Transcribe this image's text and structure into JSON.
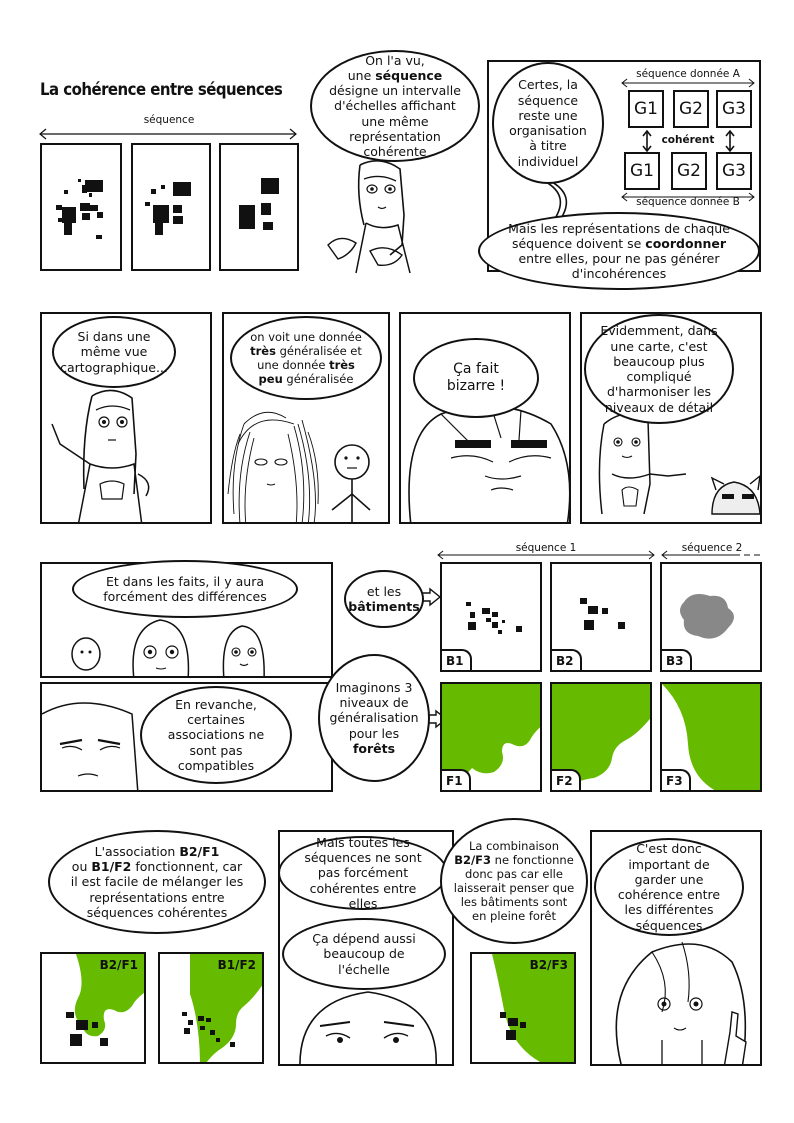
{
  "title": "La cohérence entre séquences",
  "row1": {
    "sequence_label": "séquence",
    "bubble_intro": [
      "On l'a vu,",
      "une ",
      "séquence",
      " désigne un intervalle d'échelles affichant une même représentation cohérente"
    ],
    "bubble_certes": "Certes, la séquence reste une organisation à titre individuel",
    "seq_a_label": "séquence donnée A",
    "seq_b_label": "séquence donnée B",
    "coherent_label": "cohérent",
    "groups_a": [
      "G1",
      "G2",
      "G3"
    ],
    "groups_b": [
      "G1",
      "G2",
      "G3"
    ],
    "bubble_mais": [
      "Mais les représentations de chaque séquence doivent se ",
      "coordonner",
      " entre elles, pour ne pas générer d'incohérences"
    ]
  },
  "row2": {
    "b1": "Si dans une même vue cartographique...",
    "b2": [
      "on voit une donnée ",
      "très",
      " généralisée et une donnée ",
      "très peu",
      " généralisée"
    ],
    "b3": "Ça fait bizarre !",
    "b4": "Evidemment, dans une carte, c'est beaucoup plus compliqué d'harmoniser les niveaux de détail"
  },
  "row3": {
    "b_faits": "Et dans les faits, il y aura forcément des différences",
    "b_batiments": [
      "et les ",
      "bâtiments"
    ],
    "seq1_label": "séquence 1",
    "seq2_label": "séquence 2",
    "labels_b": [
      "B1",
      "B2",
      "B3"
    ],
    "b_revanche": "En revanche, certaines associations ne sont pas compatibles",
    "b_imaginons": [
      "Imaginons 3 niveaux de généralisation pour les ",
      "forêts"
    ],
    "labels_f": [
      "F1",
      "F2",
      "F3"
    ]
  },
  "row4": {
    "b_association": [
      "L'association ",
      "B2/F1",
      " ou ",
      "B1/F2",
      " fonctionnent, car il est facile de mélanger les représentations entre séquences cohérentes"
    ],
    "labels": [
      "B2/F1",
      "B1/F2",
      "B2/F3"
    ],
    "b_toutes": "Mais toutes les séquences ne sont pas forcément cohérentes entre elles",
    "b_depend": "Ça dépend aussi beaucoup de l'échelle",
    "b_combinaison": [
      "La combinaison ",
      "B2/F3",
      " ne fonctionne donc pas car elle laisserait penser que les bâtiments sont en pleine forêt"
    ],
    "b_important": "C'est donc important de garder une cohérence entre les différentes séquences"
  },
  "colors": {
    "forest": "#66bb00",
    "blob": "#888888",
    "ink": "#111111"
  }
}
